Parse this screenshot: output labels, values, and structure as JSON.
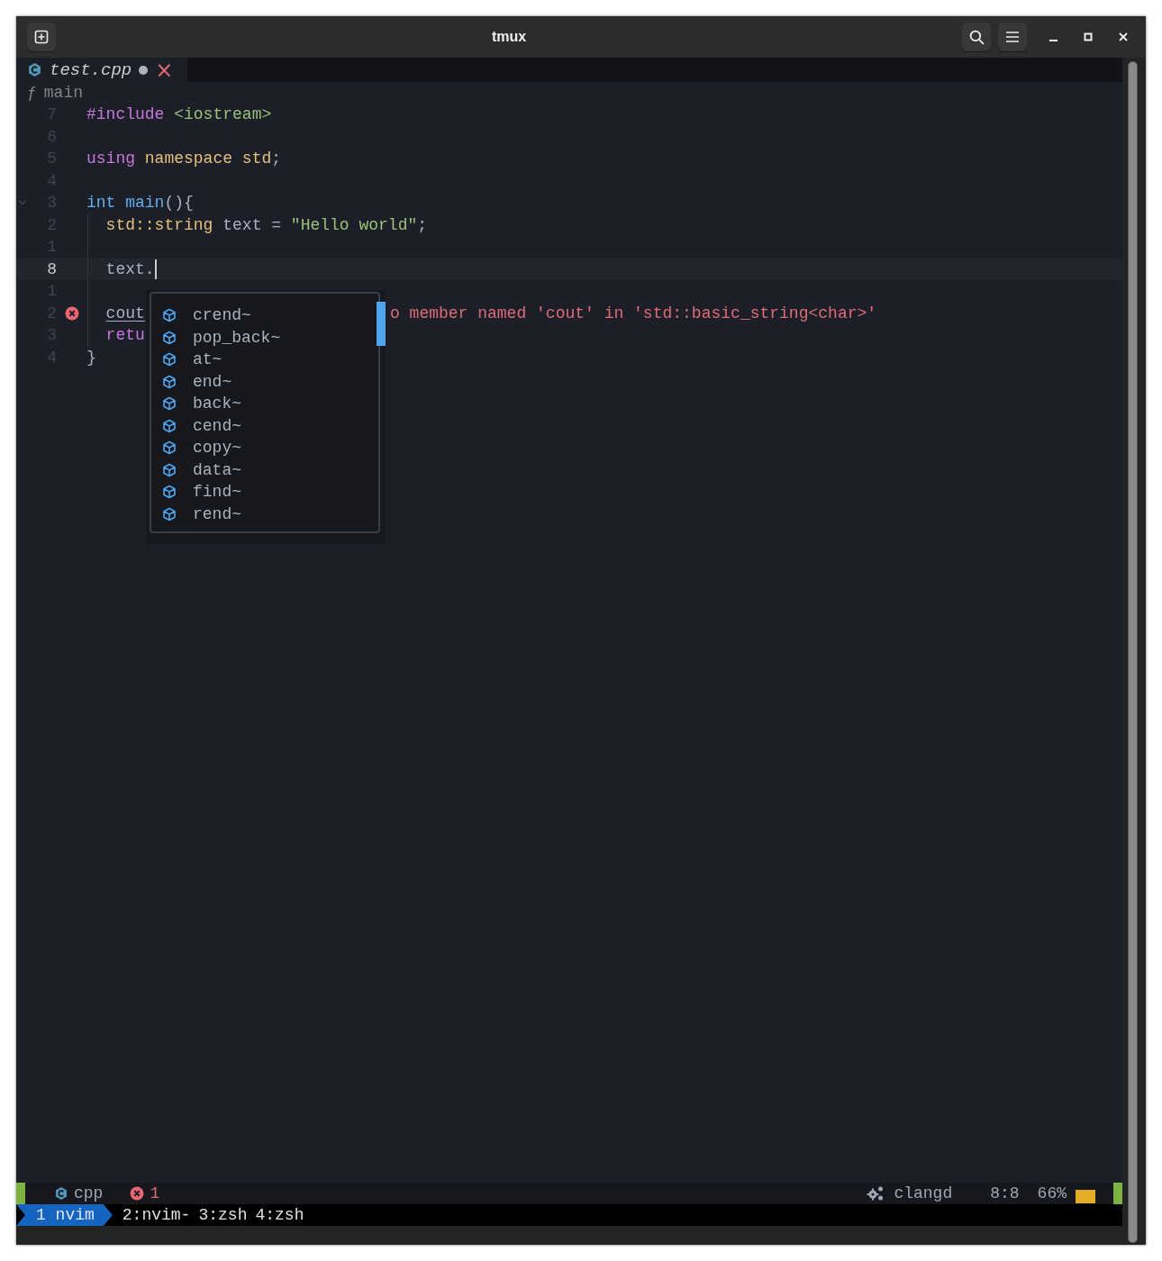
{
  "window": {
    "title": "tmux"
  },
  "tab": {
    "filename": "test.cpp",
    "modified": true,
    "close": "×"
  },
  "winbar": {
    "symbol": "ƒ",
    "name": "main"
  },
  "code": {
    "lines": [
      {
        "number": "7",
        "current": false,
        "foldable": false,
        "indented": false,
        "tokens": [
          {
            "text": "#include ",
            "kind": "preproc"
          },
          {
            "text": "<iostream>",
            "kind": "string"
          }
        ]
      },
      {
        "number": "6",
        "current": false,
        "foldable": false,
        "indented": false
      },
      {
        "number": "5",
        "current": false,
        "foldable": false,
        "indented": false,
        "tokens": [
          {
            "text": "using ",
            "kind": "keyword"
          },
          {
            "text": "namespace std",
            "kind": "namespace"
          },
          {
            "text": ";",
            "kind": "plain"
          }
        ]
      },
      {
        "number": "4",
        "current": false,
        "foldable": false,
        "indented": false
      },
      {
        "number": "3",
        "current": false,
        "foldable": true,
        "indented": false,
        "tokens": [
          {
            "text": "int ",
            "kind": "type"
          },
          {
            "text": "main",
            "kind": "func"
          },
          {
            "text": "(){",
            "kind": "plain"
          }
        ]
      },
      {
        "number": "2",
        "current": false,
        "foldable": false,
        "indented": true,
        "tokens": [
          {
            "text": "std::string",
            "kind": "namespace"
          },
          {
            "text": " text = ",
            "kind": "plain"
          },
          {
            "text": "\"Hello world\"",
            "kind": "string"
          },
          {
            "text": ";",
            "kind": "plain"
          }
        ]
      },
      {
        "number": "1",
        "current": false,
        "foldable": false,
        "indented": true
      },
      {
        "number": "8",
        "current": true,
        "foldable": false,
        "indented": true,
        "tokens": [
          {
            "text": "text.",
            "kind": "plain"
          }
        ]
      },
      {
        "number": "1",
        "current": false,
        "foldable": false,
        "indented": true
      },
      {
        "number": "2",
        "current": false,
        "foldable": false,
        "indented": true,
        "error": {
          "message": "o member named 'cout' in 'std::basic_string<char>'"
        },
        "tokens": [
          {
            "text": "cout",
            "kind": "error"
          }
        ]
      },
      {
        "number": "3",
        "current": false,
        "foldable": false,
        "indented": true,
        "tokens": [
          {
            "text": "retu",
            "kind": "keyword"
          }
        ]
      },
      {
        "number": "4",
        "current": false,
        "foldable": false,
        "indented": false,
        "tokens": [
          {
            "text": "}",
            "kind": "plain"
          }
        ]
      }
    ]
  },
  "completion": {
    "items": [
      {
        "label": "crend~"
      },
      {
        "label": "pop_back~"
      },
      {
        "label": "at~"
      },
      {
        "label": "end~"
      },
      {
        "label": "back~"
      },
      {
        "label": "cend~"
      },
      {
        "label": "copy~"
      },
      {
        "label": "data~"
      },
      {
        "label": "find~"
      },
      {
        "label": "rend~"
      }
    ]
  },
  "status_line": {
    "filetype": "cpp",
    "errors": "1",
    "lsp": "clangd",
    "position": "8:8",
    "percent": "66%"
  },
  "tmux": {
    "windows": [
      {
        "label": "1 nvim",
        "selected": true
      },
      {
        "label": "2:nvim-",
        "selected": false
      },
      {
        "label": "3:zsh",
        "selected": false
      },
      {
        "label": "4:zsh",
        "selected": false
      }
    ]
  }
}
